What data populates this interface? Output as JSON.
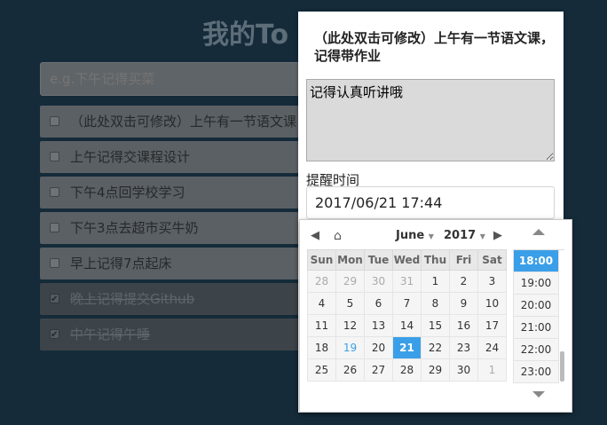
{
  "app": {
    "title": "我的To"
  },
  "new_todo": {
    "placeholder": "e.g.下午记得买菜"
  },
  "todos": [
    {
      "text": "（此处双击可修改）上午有一节语文课，记得带作业",
      "done": false
    },
    {
      "text": "上午记得交课程设计",
      "done": false
    },
    {
      "text": "下午4点回学校学习",
      "done": false
    },
    {
      "text": "下午3点去超市买牛奶",
      "done": false
    },
    {
      "text": "早上记得7点起床",
      "done": false
    },
    {
      "text": "晚上记得提交Github",
      "done": true
    },
    {
      "text": "中午记得午睡",
      "done": true
    }
  ],
  "edit_panel": {
    "title": "（此处双击可修改）上午有一节语文课，记得带作业",
    "note": "记得认真听讲哦",
    "remind_label": "提醒时间",
    "remind_value": "2017/06/21 17:44"
  },
  "picker": {
    "month": "June",
    "year": "2017",
    "weekdays": [
      "Sun",
      "Mon",
      "Tue",
      "Wed",
      "Thu",
      "Fri",
      "Sat"
    ],
    "weeks": [
      [
        "28",
        "29",
        "30",
        "31",
        "1",
        "2",
        "3"
      ],
      [
        "4",
        "5",
        "6",
        "7",
        "8",
        "9",
        "10"
      ],
      [
        "11",
        "12",
        "13",
        "14",
        "15",
        "16",
        "17"
      ],
      [
        "18",
        "19",
        "20",
        "21",
        "22",
        "23",
        "24"
      ],
      [
        "25",
        "26",
        "27",
        "28",
        "29",
        "30",
        "1"
      ]
    ],
    "selected_day": "21",
    "today_day": "19",
    "times": [
      "18:00",
      "19:00",
      "20:00",
      "21:00",
      "22:00",
      "23:00"
    ],
    "selected_time": "18:00",
    "icons": {
      "prev": "chevron-left-icon",
      "home": "home-icon",
      "next": "chevron-right-icon",
      "time_up": "chevron-up-icon",
      "time_down": "chevron-down-icon"
    },
    "colors": {
      "accent": "#3a9fe8"
    }
  }
}
